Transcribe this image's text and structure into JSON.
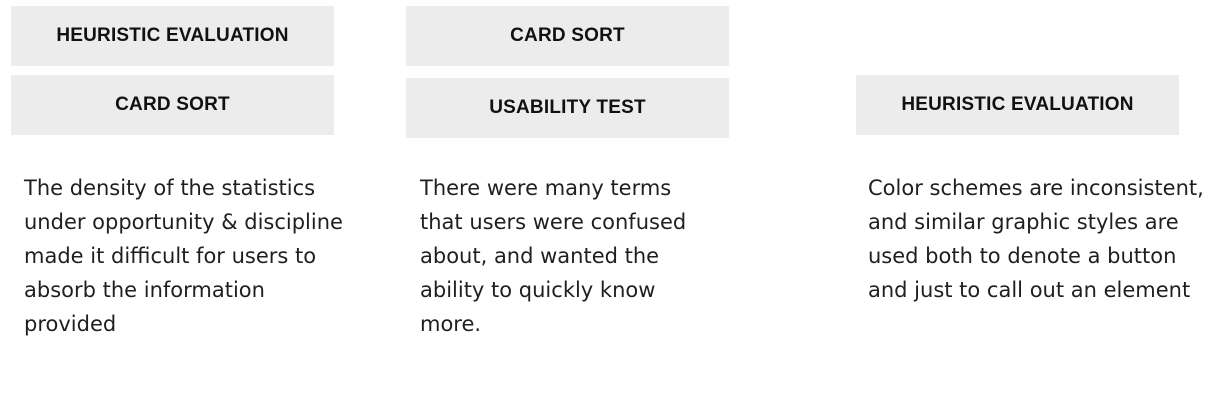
{
  "findings": [
    {
      "methods": [
        "HEURISTIC EVALUATION",
        "CARD SORT"
      ],
      "text": "The density of the statistics under opportunity & discipline made it difficult for users to absorb the information provided"
    },
    {
      "methods": [
        "CARD SORT",
        "USABILITY TEST"
      ],
      "text": "There were many terms that users were confused about, and wanted the ability to quickly know more."
    },
    {
      "methods": [
        "HEURISTIC EVALUATION"
      ],
      "text": "Color schemes are inconsistent, and similar graphic styles are used both to denote a button and just to call out an element"
    }
  ]
}
